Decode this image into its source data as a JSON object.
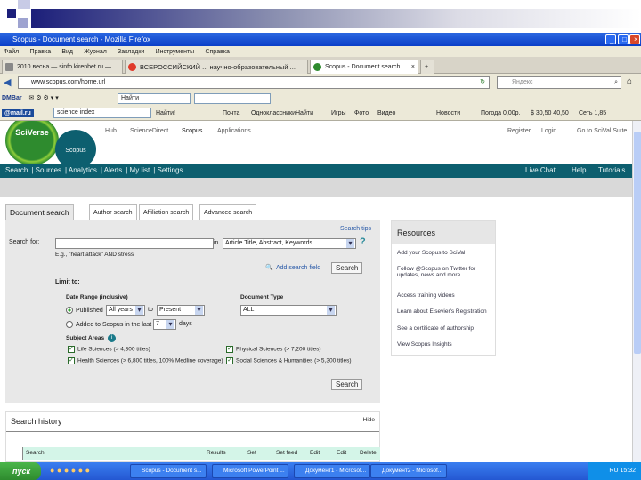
{
  "window": {
    "title": "Scopus - Document search - Mozilla Firefox"
  },
  "menu": [
    "Файл",
    "Правка",
    "Вид",
    "Журнал",
    "Закладки",
    "Инструменты",
    "Справка"
  ],
  "browser_tabs": [
    {
      "label": "2010 весна — sinfo.kirenbet.ru — ...",
      "active": false
    },
    {
      "label": "ВСЕРОССИЙСКИЙ ... научно-образовательный ...",
      "active": false
    },
    {
      "label": "Scopus - Document search",
      "active": true
    }
  ],
  "address": {
    "url": "www.scopus.com/home.url",
    "search_placeholder": "Яндекс"
  },
  "toolbar1": {
    "label": "DMBar",
    "dropdown": "Найти"
  },
  "toolbar2": {
    "brand": "@mail.ru",
    "search_value": "science index",
    "search_btn": "Найти!",
    "items": [
      "Почта",
      "Одноклассники",
      "Найти",
      "Игры",
      "Фото",
      "Видео",
      "Новости",
      "Погода 0,00р.",
      "$ 30,50 40,50",
      "Сеть 1,85"
    ]
  },
  "header": {
    "sciverse": "SciVerse",
    "scopus": "Scopus",
    "links": [
      "Hub",
      "ScienceDirect",
      "Scopus",
      "Applications"
    ],
    "register": "Register",
    "login": "Login",
    "go_to": "Go to SciVal Suite"
  },
  "main_nav": {
    "left": [
      "Search",
      "Sources",
      "Analytics",
      "Alerts",
      "My list",
      "Settings"
    ],
    "right": [
      "Live Chat",
      "Help",
      "Tutorials"
    ]
  },
  "search_tabs": [
    "Document search",
    "Author search",
    "Affiliation search",
    "Advanced search"
  ],
  "search_form": {
    "search_tips": "Search tips",
    "search_for_label": "Search for:",
    "search_value": "",
    "in_label": "in",
    "field_select": "Article Title, Abstract, Keywords",
    "example": "E.g., \"heart attack\" AND stress",
    "add_field": "Add search field",
    "search_button": "Search",
    "limit_to": "Limit to:",
    "date_range_label": "Date Range (inclusive)",
    "published_label": "Published",
    "from": "All years",
    "to_label": "to",
    "to": "Present",
    "added_label": "Added to Scopus in the last",
    "days_value": "7",
    "days_label": "days",
    "doc_type_label": "Document Type",
    "doc_type": "ALL",
    "subject_areas_label": "Subject Areas",
    "subjects": [
      {
        "label": "Life Sciences (> 4,300 titles)",
        "checked": true
      },
      {
        "label": "Physical Sciences (> 7,200 titles)",
        "checked": true
      },
      {
        "label": "Health Sciences (> 6,800 titles, 100% Medline coverage)",
        "checked": true
      },
      {
        "label": "Social Sciences & Humanities (> 5,300 titles)",
        "checked": true
      }
    ]
  },
  "resources": {
    "title": "Resources",
    "items": [
      "Add your Scopus to SciVal",
      "Follow @Scopus on Twitter for updates, news and more",
      "Access training videos",
      "Learn about Elsevier's Registration",
      "See a certificate of authorship",
      "View Scopus Insights"
    ]
  },
  "history": {
    "title": "Search history",
    "hide": "Hide",
    "columns": [
      "Search",
      "Results",
      "Set",
      "Set feed",
      "Edit",
      "Edit",
      "Delete"
    ]
  },
  "taskbar": {
    "start": "пуск",
    "tasks": [
      "Scopus - Document s...",
      "Microsoft PowerPoint ...",
      "Документ1 - Microsof...",
      "Документ2 - Microsof..."
    ],
    "clock": "15:32",
    "lang": "RU"
  }
}
